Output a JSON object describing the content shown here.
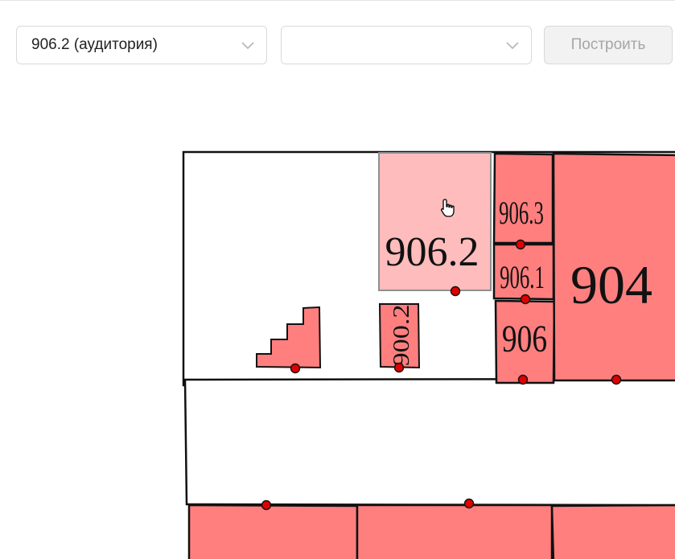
{
  "controls": {
    "room_select_value": "906.2 (аудитория)",
    "target_select_value": "",
    "build_button_label": "Построить",
    "build_button_enabled": false
  },
  "map": {
    "selected_room": "906.2",
    "rooms": [
      {
        "label": "906.2",
        "selected": true
      },
      {
        "label": "906.3",
        "selected": false
      },
      {
        "label": "906.1",
        "selected": false
      },
      {
        "label": "906",
        "selected": false
      },
      {
        "label": "904",
        "selected": false
      },
      {
        "label": "900.2",
        "selected": false
      }
    ],
    "colors": {
      "room_fill": "#ff7f7f",
      "selected_room_fill": "#ffbcbc",
      "door_marker": "#e00000",
      "wall": "#111111"
    },
    "icons": {
      "cursor": "hand-pointer-icon",
      "stairs": "stairs-icon",
      "door": "door-marker-icon"
    }
  }
}
